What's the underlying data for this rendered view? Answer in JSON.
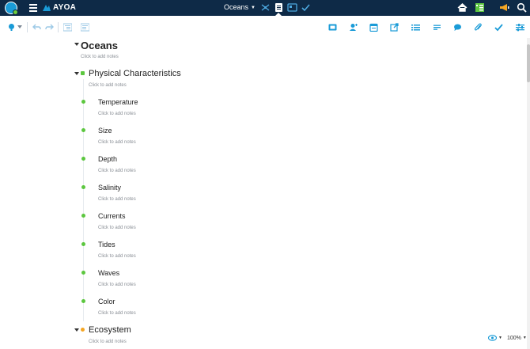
{
  "header": {
    "app_name": "AYOA",
    "doc_title": "Oceans",
    "icons": [
      "avatar",
      "menu-icon",
      "mind-map-view-icon",
      "list-view-icon",
      "board-view-icon",
      "tasks-view-icon",
      "home-icon",
      "task-board-icon",
      "announcements-icon",
      "search-icon"
    ]
  },
  "toolbar": {
    "icons": [
      "lightbulb-icon",
      "undo-icon",
      "redo-icon",
      "outline-left-icon",
      "outline-right-icon",
      "image-icon",
      "assign-user-icon",
      "calendar-icon",
      "share-icon",
      "list-icon",
      "text-icon",
      "comment-icon",
      "attachment-icon",
      "check-icon",
      "settings-icon"
    ]
  },
  "outline": {
    "root": {
      "title": "Oceans",
      "notes": "Click to add notes"
    },
    "branches": [
      {
        "title": "Physical Characteristics",
        "notes": "Click to add notes",
        "color": "#5cc73f",
        "children": [
          {
            "title": "Temperature",
            "notes": "Click to add notes"
          },
          {
            "title": "Size",
            "notes": "Click to add notes"
          },
          {
            "title": "Depth",
            "notes": "Click to add notes"
          },
          {
            "title": "Salinity",
            "notes": "Click to add notes"
          },
          {
            "title": "Currents",
            "notes": "Click to add notes"
          },
          {
            "title": "Tides",
            "notes": "Click to add notes"
          },
          {
            "title": "Waves",
            "notes": "Click to add notes"
          },
          {
            "title": "Color",
            "notes": "Click to add notes"
          }
        ]
      },
      {
        "title": "Ecosystem",
        "notes": "Click to add notes",
        "color": "#f5a623"
      }
    ]
  },
  "footer": {
    "zoom": "100%"
  },
  "colors": {
    "header_bg": "#0e2a47",
    "accent": "#1a9bd7",
    "green": "#5cc73f",
    "orange": "#f5a623"
  }
}
